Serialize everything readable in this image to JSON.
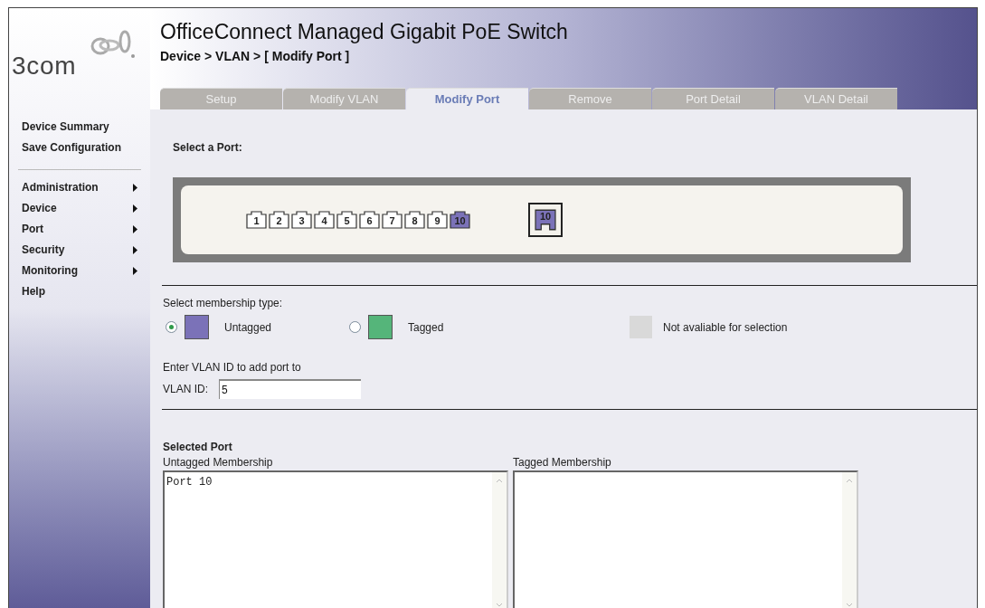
{
  "logo": {
    "text": "3com"
  },
  "header": {
    "title": "OfficeConnect Managed Gigabit PoE Switch",
    "breadcrumb": "Device > VLAN > [ Modify Port ]"
  },
  "tabs": [
    {
      "label": "Setup",
      "selected": false
    },
    {
      "label": "Modify VLAN",
      "selected": false
    },
    {
      "label": "Modify Port",
      "selected": true
    },
    {
      "label": "Remove",
      "selected": false
    },
    {
      "label": "Port Detail",
      "selected": false
    },
    {
      "label": "VLAN Detail",
      "selected": false
    }
  ],
  "sidebar": {
    "links": [
      "Device Summary",
      "Save Configuration"
    ],
    "items": [
      {
        "label": "Administration",
        "submenu": true
      },
      {
        "label": "Device",
        "submenu": true
      },
      {
        "label": "Port",
        "submenu": true
      },
      {
        "label": "Security",
        "submenu": true
      },
      {
        "label": "Monitoring",
        "submenu": true
      },
      {
        "label": "Help",
        "submenu": false
      }
    ]
  },
  "port_select": {
    "label": "Select a Port:",
    "ports": [
      {
        "label": "1",
        "selected": false
      },
      {
        "label": "2",
        "selected": false
      },
      {
        "label": "3",
        "selected": false
      },
      {
        "label": "4",
        "selected": false
      },
      {
        "label": "5",
        "selected": false
      },
      {
        "label": "6",
        "selected": false
      },
      {
        "label": "7",
        "selected": false
      },
      {
        "label": "8",
        "selected": false
      },
      {
        "label": "9",
        "selected": false
      },
      {
        "label": "10",
        "selected": true
      }
    ],
    "uplink_port": {
      "label": "10",
      "selected": true
    }
  },
  "membership": {
    "label": "Select membership type:",
    "options": [
      {
        "label": "Untagged",
        "selected": true,
        "color": "#7b72b8"
      },
      {
        "label": "Tagged",
        "selected": false,
        "color": "#55b57a"
      }
    ],
    "unavailable": {
      "label": "Not avaliable for selection",
      "color": "#d9d9d9"
    }
  },
  "vlan": {
    "prompt": "Enter VLAN ID to add port to",
    "label": "VLAN ID:",
    "value": "5"
  },
  "selected_port": {
    "title": "Selected Port",
    "lists": [
      {
        "label": "Untagged Membership",
        "value": "Port 10"
      },
      {
        "label": "Tagged Membership"
      }
    ]
  }
}
